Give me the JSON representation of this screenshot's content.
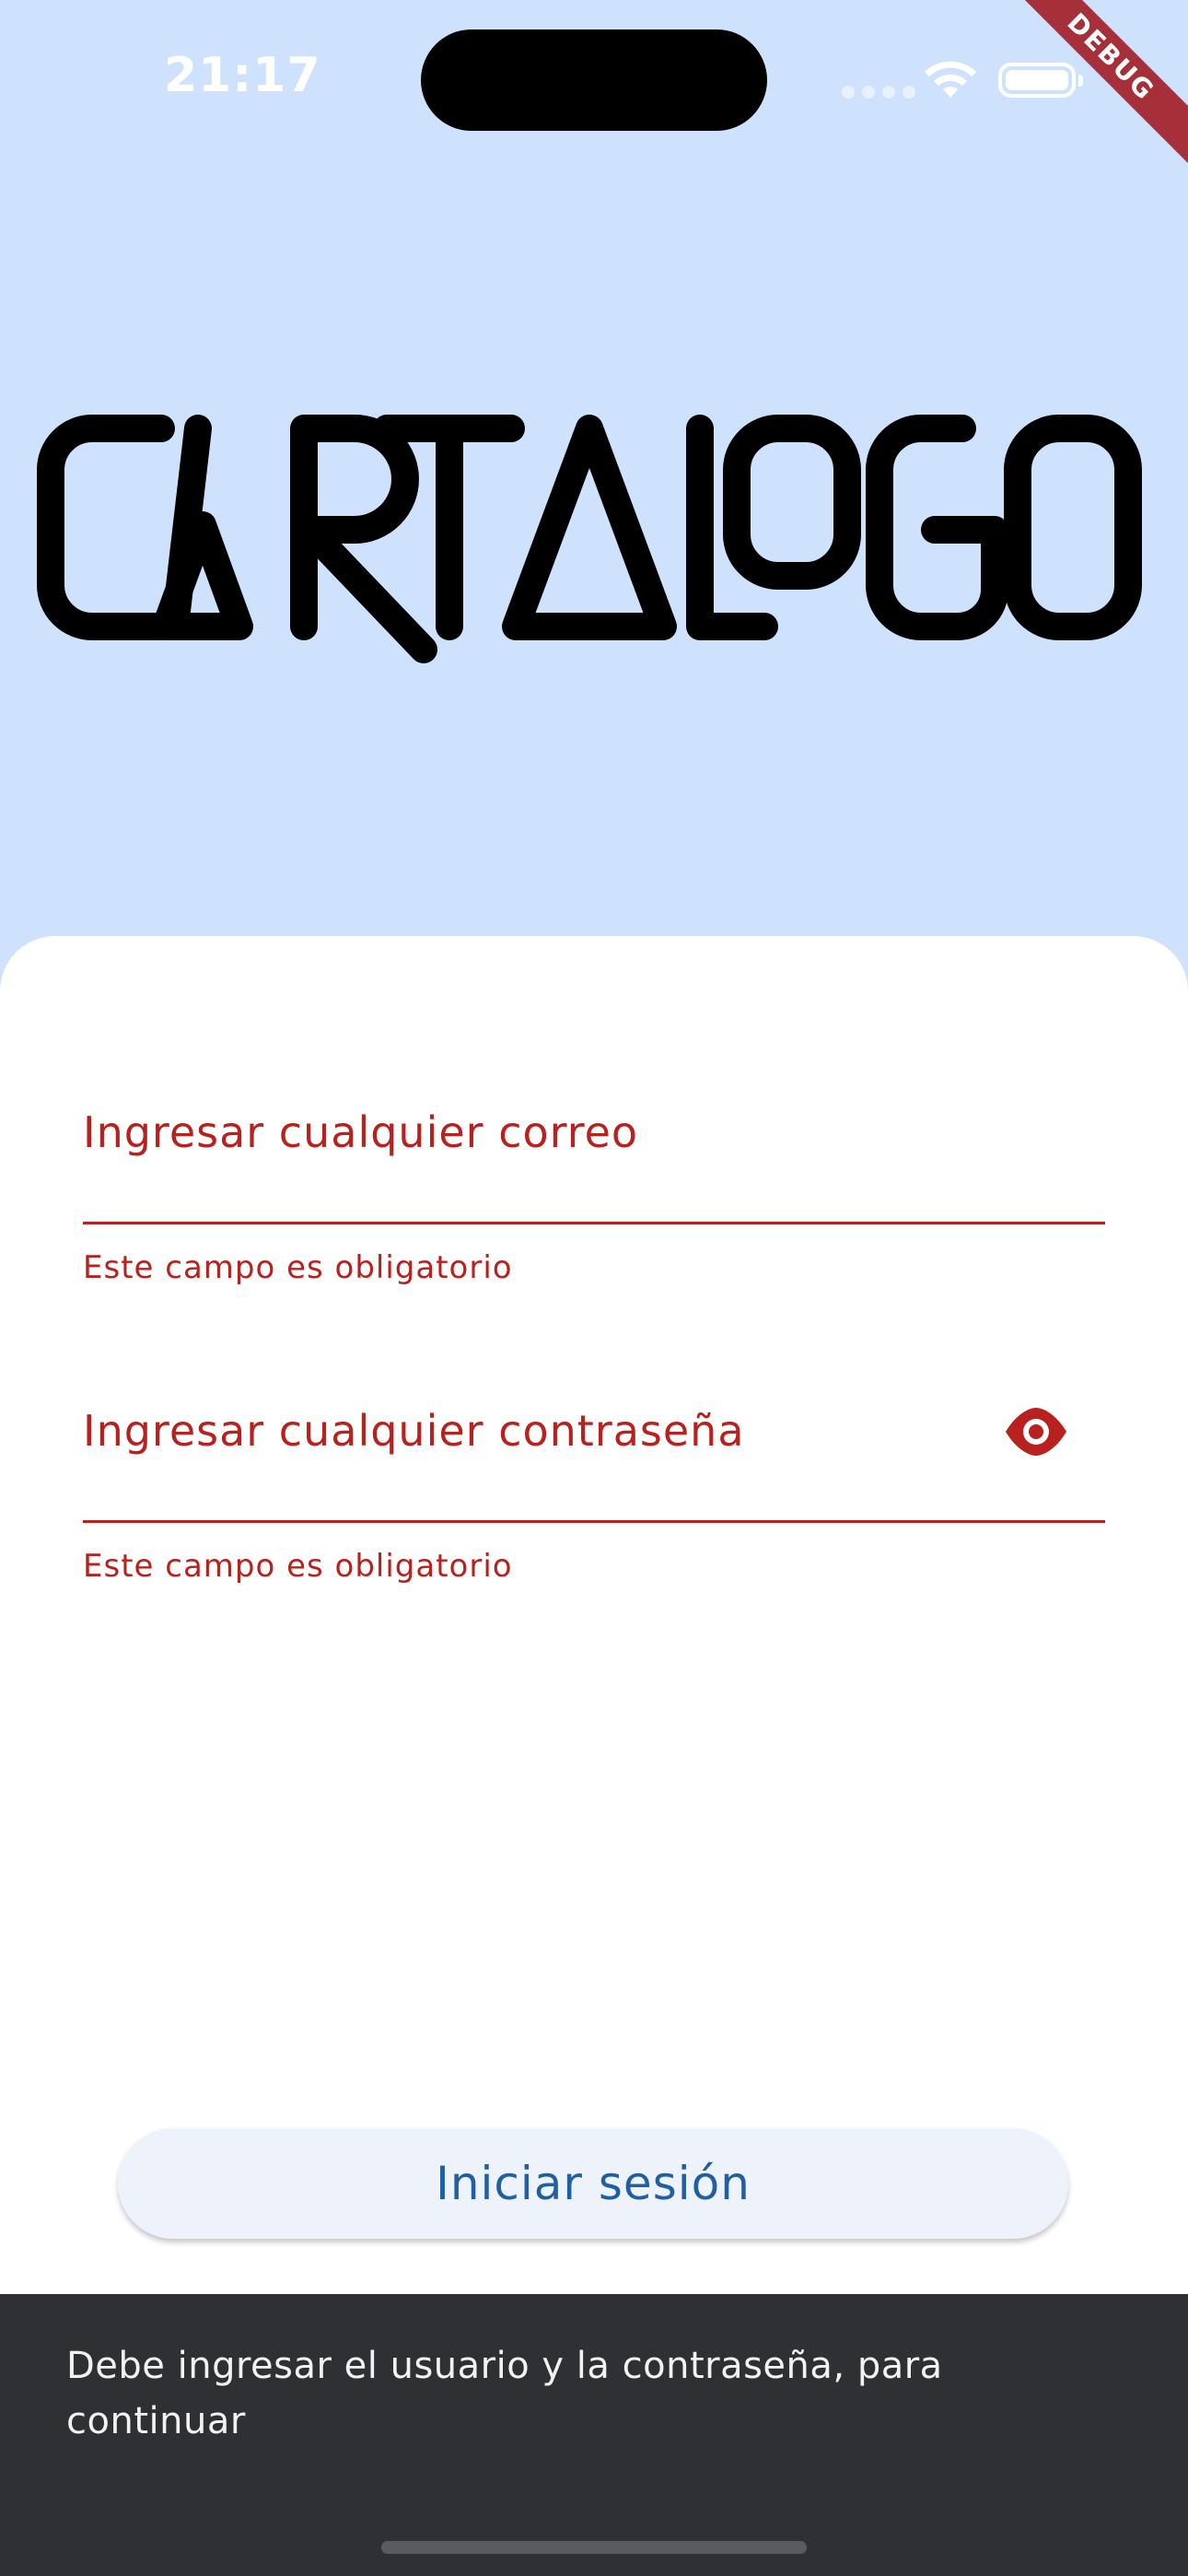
{
  "status_bar": {
    "time": "21:17",
    "icons": [
      "signal-dots-icon",
      "wifi-icon",
      "battery-icon"
    ]
  },
  "debug_banner": "DEBUG",
  "logo": {
    "text": "CARTALOGO"
  },
  "form": {
    "email": {
      "placeholder": "Ingresar cualquier correo",
      "error": "Este campo es obligatorio"
    },
    "password": {
      "placeholder": "Ingresar cualquier contraseña",
      "error": "Este campo es obligatorio",
      "toggle_icon": "eye-icon"
    }
  },
  "login_button": {
    "label": "Iniciar sesión"
  },
  "snackbar": {
    "message": "Debe ingresar el usuario y la contraseña, para continuar"
  },
  "colors": {
    "background": "#cfe2fd",
    "error": "#b8211e",
    "button_text": "#1f5fa2",
    "snackbar": "#2f3034"
  }
}
